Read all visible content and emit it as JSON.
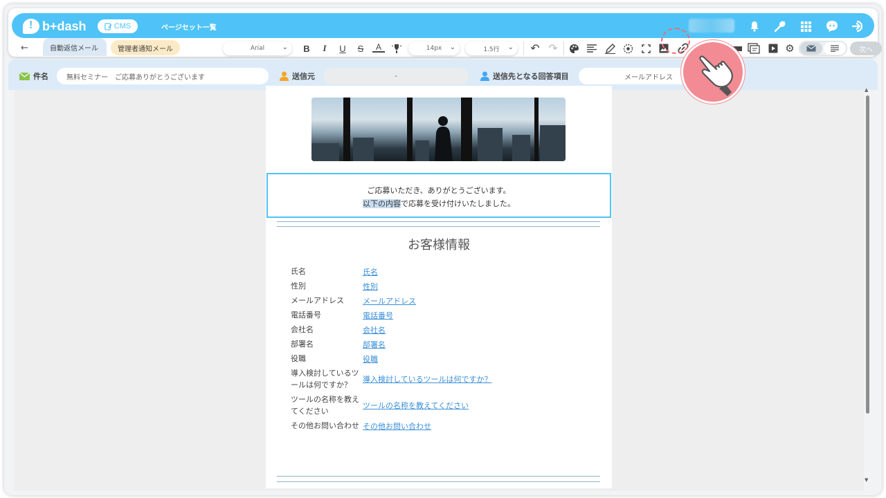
{
  "header": {
    "logo_text": "b+dash",
    "cms_label": "CMS",
    "page_title": "ページセット一覧"
  },
  "toolbar": {
    "tabs": [
      {
        "label": "自動返信メール",
        "active": true
      },
      {
        "label": "管理者通知メール",
        "active": false
      }
    ],
    "font_family": "Arial",
    "font_size": "14px",
    "line_height": "1.5行",
    "next_label": "次へ"
  },
  "subject_row": {
    "subject_label": "件名",
    "subject_value": "無料セミナー　ご応募ありがとうございます",
    "sender_label": "送信元",
    "sender_value": "-",
    "recipient_label": "送信先となる回答項目",
    "recipient_value": "メールアドレス"
  },
  "content": {
    "greeting_line1": "ご応募いただき、ありがとうございます。",
    "greeting_line2_highlight": "以下の内容",
    "greeting_line2_rest": "で応募を受け付けいたしました。",
    "section_title": "お客様情報",
    "rows": [
      {
        "key": "氏名",
        "value": "氏名"
      },
      {
        "key": "性別",
        "value": "性別"
      },
      {
        "key": "メールアドレス",
        "value": "メールアドレス"
      },
      {
        "key": "電話番号",
        "value": "電話番号"
      },
      {
        "key": "会社名",
        "value": "会社名"
      },
      {
        "key": "部署名",
        "value": "部署名"
      },
      {
        "key": "役職",
        "value": "役職"
      },
      {
        "key": "導入検討しているツールは何ですか？",
        "value": "導入検討しているツールは何ですか？"
      },
      {
        "key": "ツールの名称を教えてください",
        "value": "ツールの名称を教えてください"
      },
      {
        "key": "その他お問い合わせ",
        "value": "その他お問い合わせ"
      }
    ]
  },
  "colors": {
    "brand": "#4fc3f7",
    "link": "#3a8fd8",
    "pointer": "#f28b94"
  }
}
